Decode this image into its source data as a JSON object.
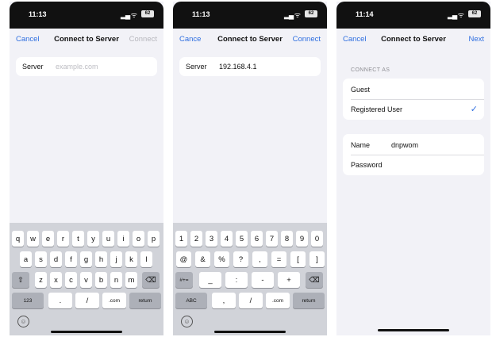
{
  "phones": [
    {
      "status": {
        "time": "11:13",
        "battery": "62"
      },
      "nav": {
        "cancel": "Cancel",
        "title": "Connect to Server",
        "action": "Connect"
      },
      "field": {
        "label": "Server",
        "placeholder": "example.com"
      },
      "keyboard": {
        "row1": [
          "q",
          "w",
          "e",
          "r",
          "t",
          "y",
          "u",
          "i",
          "o",
          "p"
        ],
        "row2": [
          "a",
          "s",
          "d",
          "f",
          "g",
          "h",
          "j",
          "k",
          "l"
        ],
        "row3": [
          "z",
          "x",
          "c",
          "v",
          "b",
          "n",
          "m"
        ],
        "row4": [
          "123",
          ".",
          "/",
          ".com",
          "return"
        ]
      }
    },
    {
      "status": {
        "time": "11:13",
        "battery": "62"
      },
      "nav": {
        "cancel": "Cance",
        "title": "Connect to Server",
        "action": "Connect"
      },
      "field": {
        "label": "Server",
        "value": "192.168.4.1"
      },
      "keyboard": {
        "row1": [
          "1",
          "2",
          "3",
          "4",
          "5",
          "6",
          "7",
          "8",
          "9",
          "0"
        ],
        "row2": [
          "@",
          "&",
          "%",
          "?",
          ",",
          "=",
          "[",
          "]"
        ],
        "row3": [
          "_",
          ":",
          "-",
          "+"
        ],
        "row4": [
          "ABC",
          ",",
          "/",
          ".com",
          "return"
        ]
      }
    },
    {
      "status": {
        "time": "11:14",
        "battery": "62"
      },
      "nav": {
        "cancel": "Cancel",
        "title": "Connect to Server",
        "action": "Next"
      },
      "connect_as": "CONNECT AS",
      "options": [
        "Guest",
        "Registered User"
      ],
      "name_label": "Name",
      "name_value": "dnpwom",
      "password_label": "Password"
    }
  ]
}
